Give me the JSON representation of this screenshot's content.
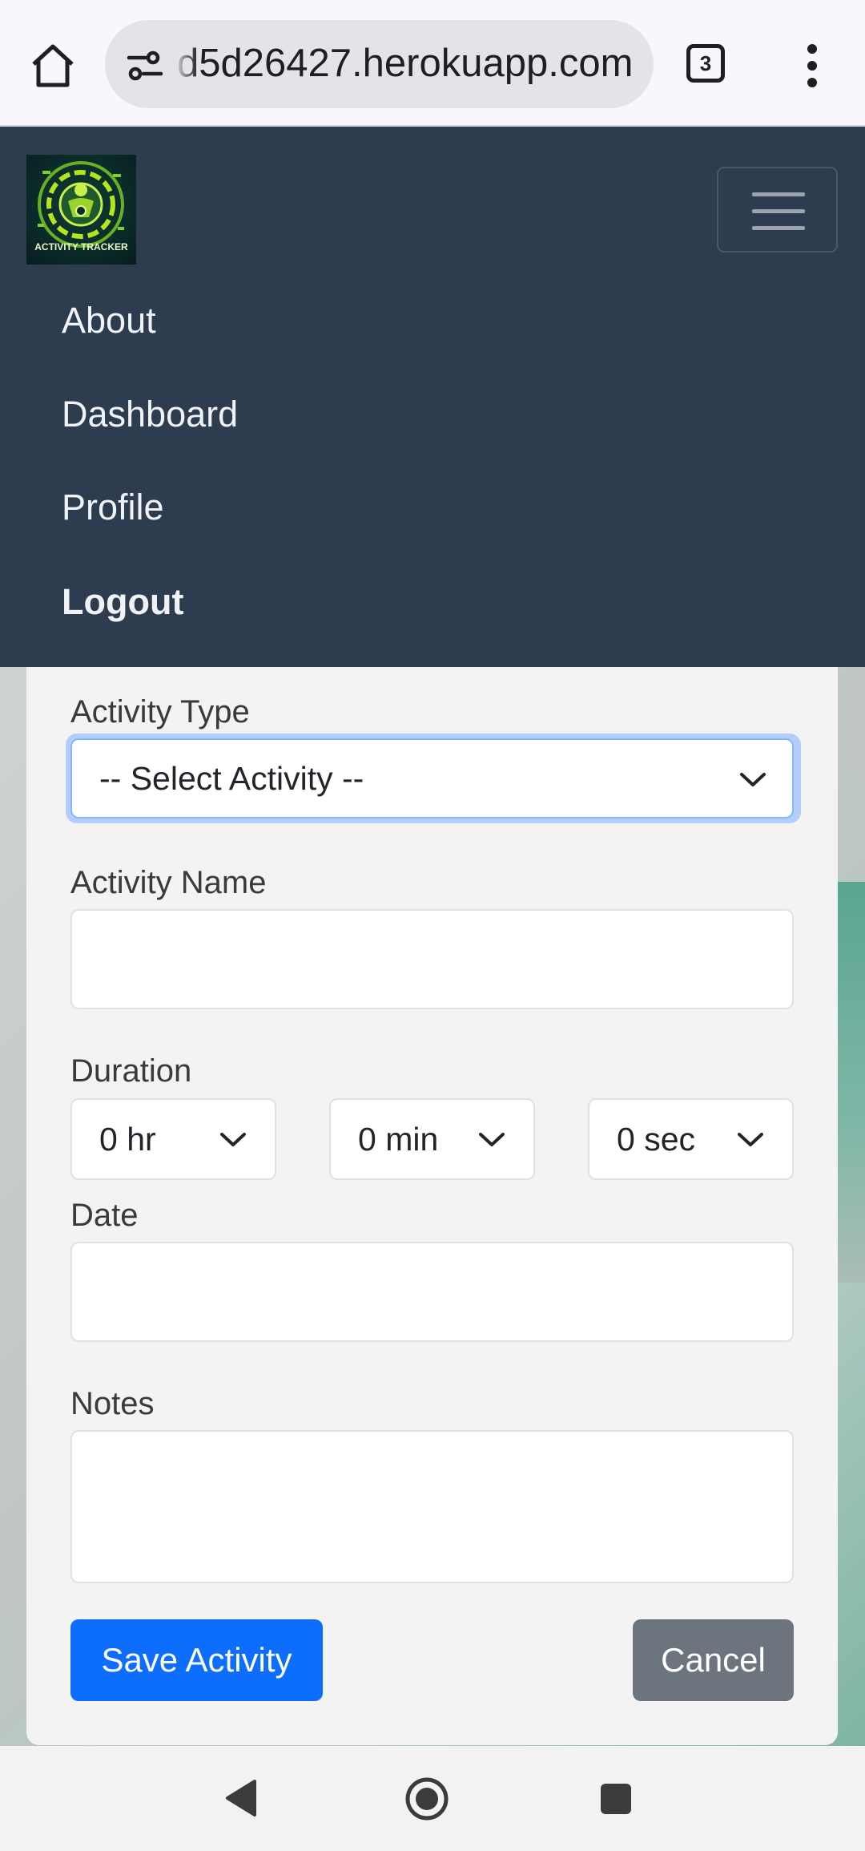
{
  "browser": {
    "url": "d5d26427.herokuapp.com",
    "tab_count": "3",
    "icons": [
      "home-icon",
      "site-settings-icon",
      "tab-switcher-icon",
      "more-vert-icon"
    ]
  },
  "navbar": {
    "logo_text": "ACTIVITY TRACKER",
    "items": [
      {
        "label": "About"
      },
      {
        "label": "Dashboard"
      },
      {
        "label": "Profile"
      },
      {
        "label": "Logout"
      }
    ],
    "colors": {
      "background": "#2e3c4f"
    }
  },
  "form": {
    "activity_type": {
      "label": "Activity Type",
      "selected": "-- Select Activity --"
    },
    "activity_name": {
      "label": "Activity Name",
      "value": ""
    },
    "duration": {
      "label": "Duration",
      "hours": "0 hr",
      "minutes": "0 min",
      "seconds": "0 sec"
    },
    "date": {
      "label": "Date",
      "value": ""
    },
    "notes": {
      "label": "Notes",
      "value": ""
    },
    "save_label": "Save Activity",
    "cancel_label": "Cancel",
    "colors": {
      "primary": "#0d6efd",
      "secondary": "#6c757d",
      "focus": "#86b6fc"
    }
  },
  "system_nav": {
    "icons": [
      "back-icon",
      "home-circle-icon",
      "recents-icon"
    ]
  }
}
